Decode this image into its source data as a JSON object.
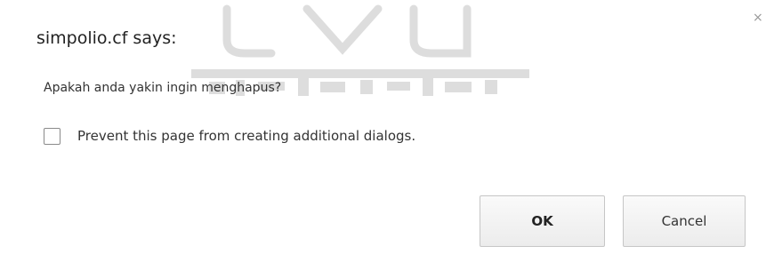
{
  "dialog": {
    "title": "simpolio.cf says:",
    "message": "Apakah anda yakin ingin menghapus?",
    "prevent_label": "Prevent this page from creating additional dialogs.",
    "prevent_checked": false,
    "close_glyph": "×",
    "ok_label": "OK",
    "cancel_label": "Cancel"
  },
  "icons": {
    "close": "close-icon",
    "watermark": "university-logo-watermark"
  },
  "colors": {
    "background": "#ffffff",
    "button_border": "#c6c6c6",
    "text": "#333333"
  }
}
